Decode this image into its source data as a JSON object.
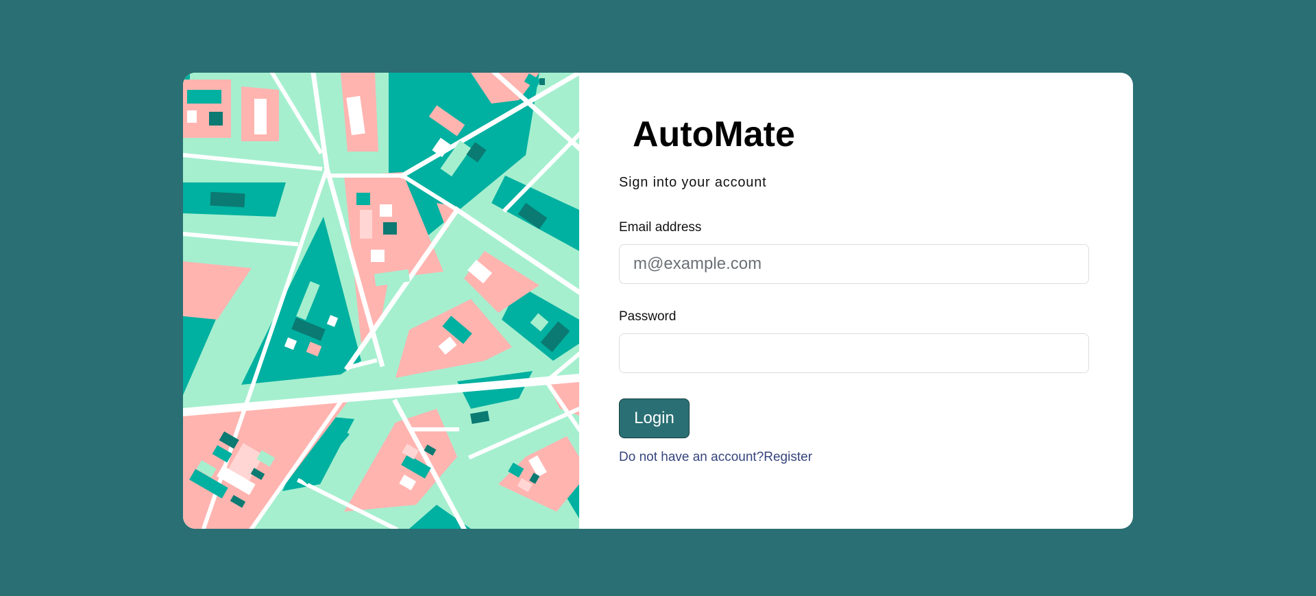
{
  "colors": {
    "background": "#2a6f73",
    "card": "#ffffff",
    "button": "#2a6f73",
    "link": "#36447e",
    "map_mint": "#a5efcf",
    "map_teal": "#00b0a0",
    "map_dark_teal": "#0b7a72",
    "map_pink": "#ffb4b0",
    "map_road": "#ffffff"
  },
  "illustration": {
    "icon": "city-map-illustration"
  },
  "login": {
    "app_title": "AutoMate",
    "subtitle": "Sign into your account",
    "email_label": "Email address",
    "email_placeholder": "m@example.com",
    "email_value": "",
    "password_label": "Password",
    "password_value": "",
    "login_button": "Login",
    "no_account_text": "Do not have an account?",
    "register_link": "Register"
  }
}
